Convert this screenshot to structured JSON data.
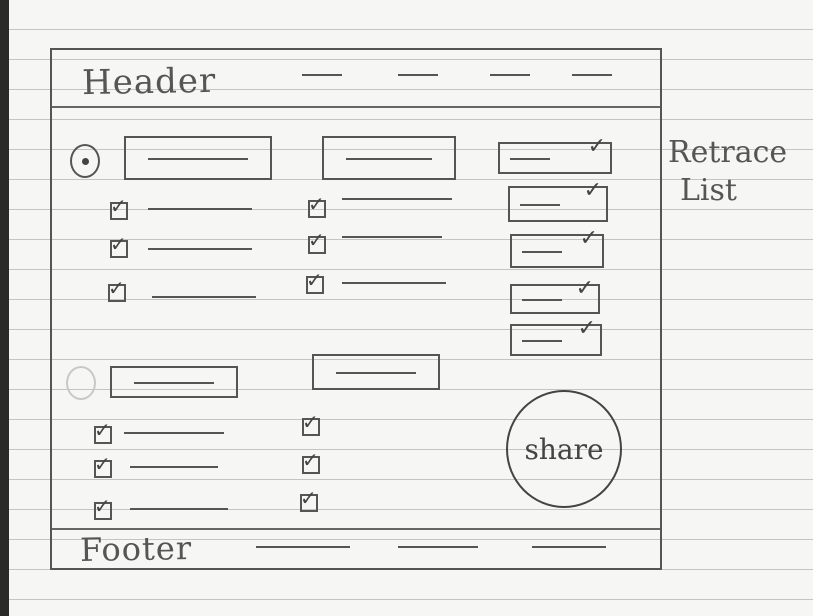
{
  "header": {
    "title": "Header",
    "nav_links": [
      "",
      "",
      "",
      ""
    ]
  },
  "footer": {
    "title": "Footer",
    "links": [
      "",
      "",
      ""
    ]
  },
  "group1": {
    "radio_selected": true,
    "columns": [
      {
        "input_value": "",
        "items": [
          {
            "checked": true,
            "text": ""
          },
          {
            "checked": true,
            "text": ""
          },
          {
            "checked": true,
            "text": ""
          }
        ]
      },
      {
        "input_value": "",
        "items": [
          {
            "checked": true,
            "text": ""
          },
          {
            "checked": true,
            "text": ""
          },
          {
            "checked": true,
            "text": ""
          }
        ]
      }
    ]
  },
  "group2": {
    "radio_selected": false,
    "columns": [
      {
        "input_value": "",
        "items": [
          {
            "checked": true,
            "text": ""
          },
          {
            "checked": true,
            "text": ""
          },
          {
            "checked": true,
            "text": ""
          }
        ]
      },
      {
        "input_value": "",
        "items": [
          {
            "checked": true
          },
          {
            "checked": true
          },
          {
            "checked": true
          }
        ]
      }
    ]
  },
  "retrace_list": {
    "label_line1": "Retrace",
    "label_line2": "List",
    "items": [
      {
        "checked": true
      },
      {
        "checked": true
      },
      {
        "checked": true
      },
      {
        "checked": true
      },
      {
        "checked": true
      }
    ]
  },
  "share_button": {
    "label": "share"
  },
  "icons": {
    "checkmark": "check-icon",
    "radio": "radio-icon"
  }
}
